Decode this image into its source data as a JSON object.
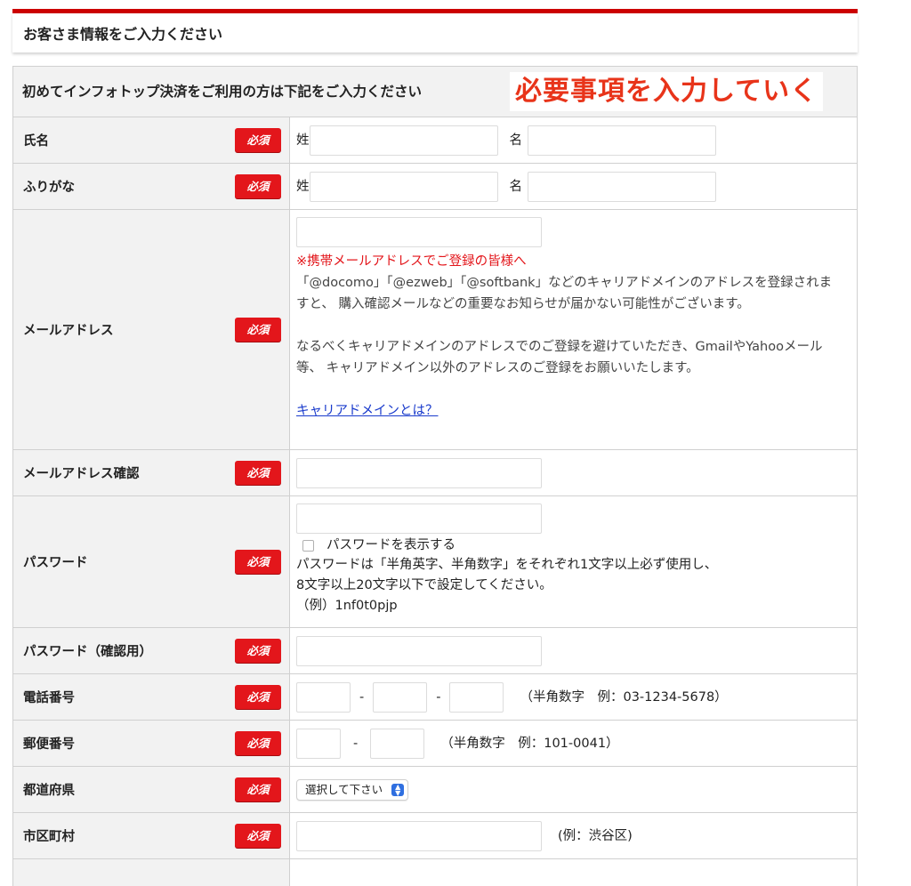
{
  "section": {
    "title": "お客さま情報をご入力ください"
  },
  "form_header": "初めてインフォトップ決済をご利用の方は下記をご入力ください",
  "annotation": "必要事項を入力していく",
  "required_badge": "必須",
  "fields": {
    "name": {
      "label": "氏名",
      "last_prefix": "姓",
      "first_prefix": "名",
      "last_value": "",
      "first_value": ""
    },
    "kana": {
      "label": "ふりがな",
      "last_prefix": "姓",
      "first_prefix": "名",
      "last_value": "",
      "first_value": ""
    },
    "email": {
      "label": "メールアドレス",
      "value": "",
      "warning": "※携帯メールアドレスでご登録の皆様へ",
      "note1": "「@docomo」「@ezweb」「@softbank」などのキャリアドメインのアドレスを登録されますと、 購入確認メールなどの重要なお知らせが届かない可能性がございます。",
      "note2": "なるべくキャリアドメインのアドレスでのご登録を避けていただき、GmailやYahooメール等、 キャリアドメイン以外のアドレスのご登録をお願いいたします。",
      "link": "キャリアドメインとは？"
    },
    "email_confirm": {
      "label": "メールアドレス確認",
      "value": ""
    },
    "password": {
      "label": "パスワード",
      "value": "",
      "show_label": "パスワードを表示する",
      "note1": "パスワードは「半角英字、半角数字」をそれぞれ1文字以上必ず使用し、",
      "note2": "8文字以上20文字以下で設定してください。",
      "note3": "（例）1nf0t0pjp"
    },
    "password_confirm": {
      "label": "パスワード（確認用）",
      "value": ""
    },
    "phone": {
      "label": "電話番号",
      "dash": "-",
      "hint": "（半角数字　例：03-1234-5678）",
      "values": [
        "",
        "",
        ""
      ]
    },
    "postal": {
      "label": "郵便番号",
      "dash": "-",
      "hint": "（半角数字　例：101-0041）",
      "values": [
        "",
        ""
      ]
    },
    "prefecture": {
      "label": "都道府県",
      "selected": "選択して下さい"
    },
    "city": {
      "label": "市区町村",
      "value": "",
      "hint": "(例：渋谷区)"
    }
  }
}
